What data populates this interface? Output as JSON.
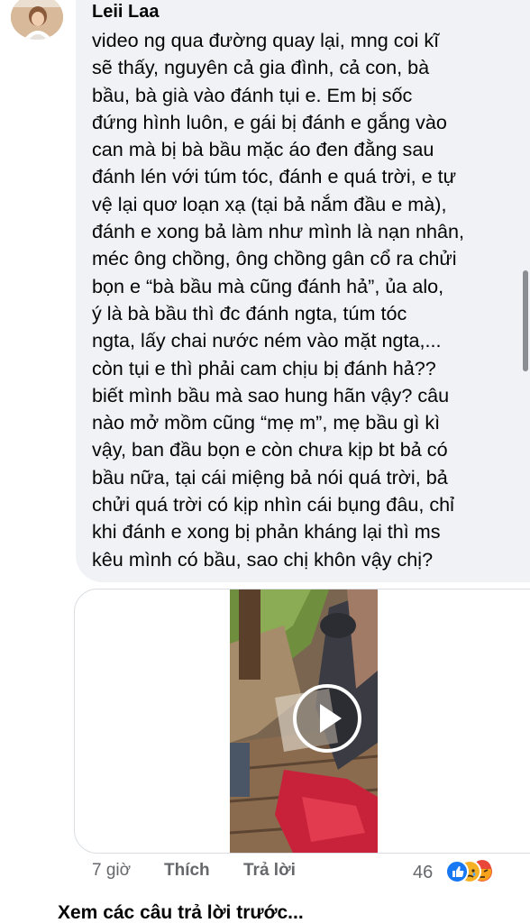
{
  "comment": {
    "author": "Leii Laa",
    "lines": [
      "video ng qua đường quay lại, mng coi kĩ",
      "sẽ thấy, nguyên cả gia đình, cả con, bà",
      "bầu, bà già vào đánh tụi e. Em bị sốc",
      "đứng hình luôn, e gái bị đánh e gắng vào",
      "can mà bị bà bầu mặc áo đen đằng sau",
      "đánh lén với túm tóc, đánh e quá trời, e tự",
      "vệ lại quơ loạn xạ (tại bả nắm đầu e mà),",
      "đánh e xong bả làm như mình là nạn nhân,",
      "méc ông chồng, ông chồng gân cổ ra chửi",
      "bọn e “bà bầu mà cũng đánh hả”, ủa alo,",
      "ý là bà bầu thì đc đánh ngta, túm tóc",
      "ngta, lấy chai nước ném vào mặt ngta,...",
      "còn tụi e thì phải cam chịu bị đánh hả??",
      "biết mình bầu mà sao hung hãn vậy? câu",
      "nào mở mồm cũng “mẹ m”, mẹ bầu gì kì",
      "vậy, ban đầu bọn e còn chưa kịp bt bả có",
      "bầu nữa, tại cái miệng bả nói quá trời, bả",
      "chửi quá trời có kịp nhìn cái bụng đâu, chỉ",
      "khi đánh e xong bị phản kháng lại thì ms",
      "kêu mình có bầu, sao chị khôn vậy chị?"
    ]
  },
  "actions": {
    "time": "7 giờ",
    "like": "Thích",
    "reply": "Trả lời",
    "reaction_count": "46",
    "reaction_icons": [
      "like-icon",
      "sad-icon",
      "angry-icon"
    ]
  },
  "view_more": "Xem các câu trả lời trước...",
  "colors": {
    "bubble": "#f0f2f5",
    "secondary_text": "#65676b",
    "like_blue": "#1877f2",
    "sad_yellow": "#f7b125",
    "angry_red": "#e9710f"
  }
}
